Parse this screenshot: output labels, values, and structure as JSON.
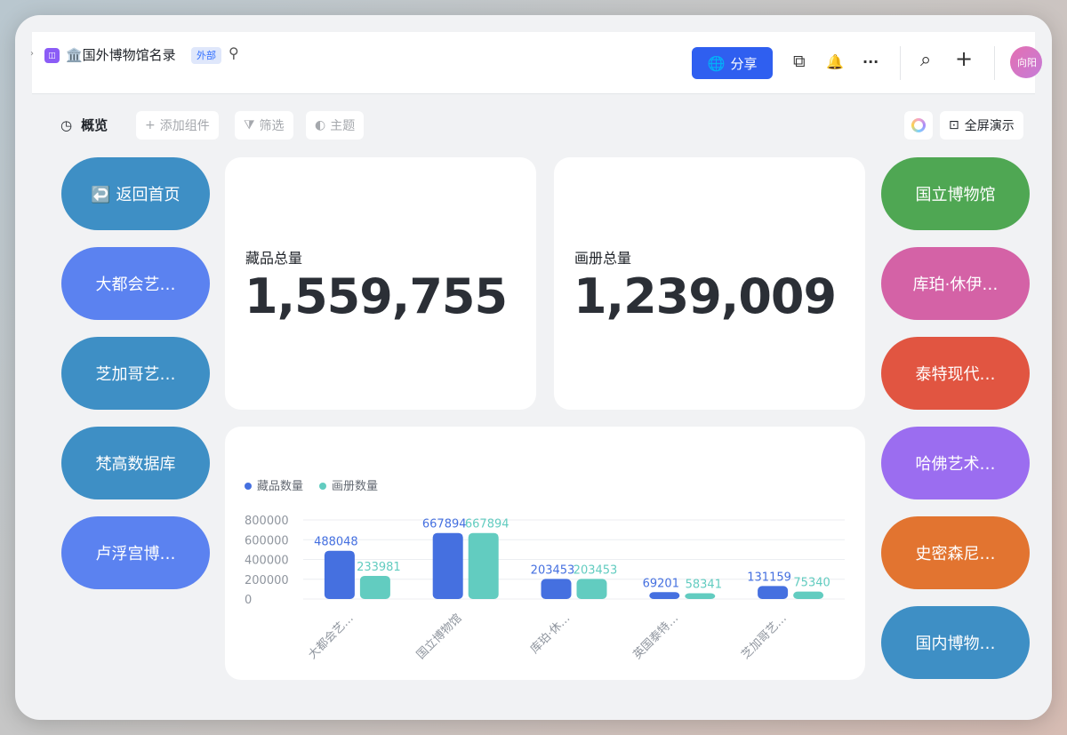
{
  "topbar": {
    "chevron": "›",
    "app_icon": "◫",
    "title": "🏛️国外博物馆名录",
    "tag": "外部",
    "pin_icon": "⚲",
    "share_label": "分享",
    "globe_icon": "🌐",
    "plugin_icon": "⧉",
    "bell_icon": "🔔",
    "more_icon": "···",
    "search_icon": "⌕",
    "add_icon": "+",
    "avatar_text": "向阳"
  },
  "toolbar": {
    "overview_icon": "◷",
    "overview_label": "概览",
    "add_widget": "添加组件",
    "filter": "筛选",
    "theme": "主题",
    "present": "全屏演示"
  },
  "left_buttons": [
    {
      "label": "↩️ 返回首页",
      "color": "#3e8fc5"
    },
    {
      "label": "大都会艺…",
      "color": "#5b82f0"
    },
    {
      "label": "芝加哥艺…",
      "color": "#3e8fc5"
    },
    {
      "label": "梵高数据库",
      "color": "#3e8fc5"
    },
    {
      "label": "卢浮宫博…",
      "color": "#5b82f0"
    }
  ],
  "right_buttons": [
    {
      "label": "国立博物馆",
      "color": "#4fa753"
    },
    {
      "label": "库珀·休伊…",
      "color": "#d462a6"
    },
    {
      "label": "泰特现代…",
      "color": "#e15541"
    },
    {
      "label": "哈佛艺术…",
      "color": "#9b6df0"
    },
    {
      "label": "史密森尼…",
      "color": "#e27430"
    },
    {
      "label": "国内博物…",
      "color": "#3e8fc5"
    }
  ],
  "metrics": [
    {
      "label": "藏品总量",
      "value": "1,559,755"
    },
    {
      "label": "画册总量",
      "value": "1,239,009"
    }
  ],
  "chart_data": {
    "type": "bar",
    "categories": [
      "大都会艺…",
      "国立博物馆",
      "库珀·休…",
      "英国泰特…",
      "芝加哥艺…"
    ],
    "series": [
      {
        "name": "藏品数量",
        "color": "#4570e0",
        "values": [
          488048,
          667894,
          203453,
          69201,
          131159
        ]
      },
      {
        "name": "画册数量",
        "color": "#62ccc0",
        "values": [
          233981,
          667894,
          203453,
          58341,
          75340
        ]
      }
    ],
    "yticks": [
      800000,
      600000,
      400000,
      200000,
      0
    ],
    "ylim": [
      0,
      800000
    ],
    "legend_position": "top-left",
    "grid": true
  }
}
